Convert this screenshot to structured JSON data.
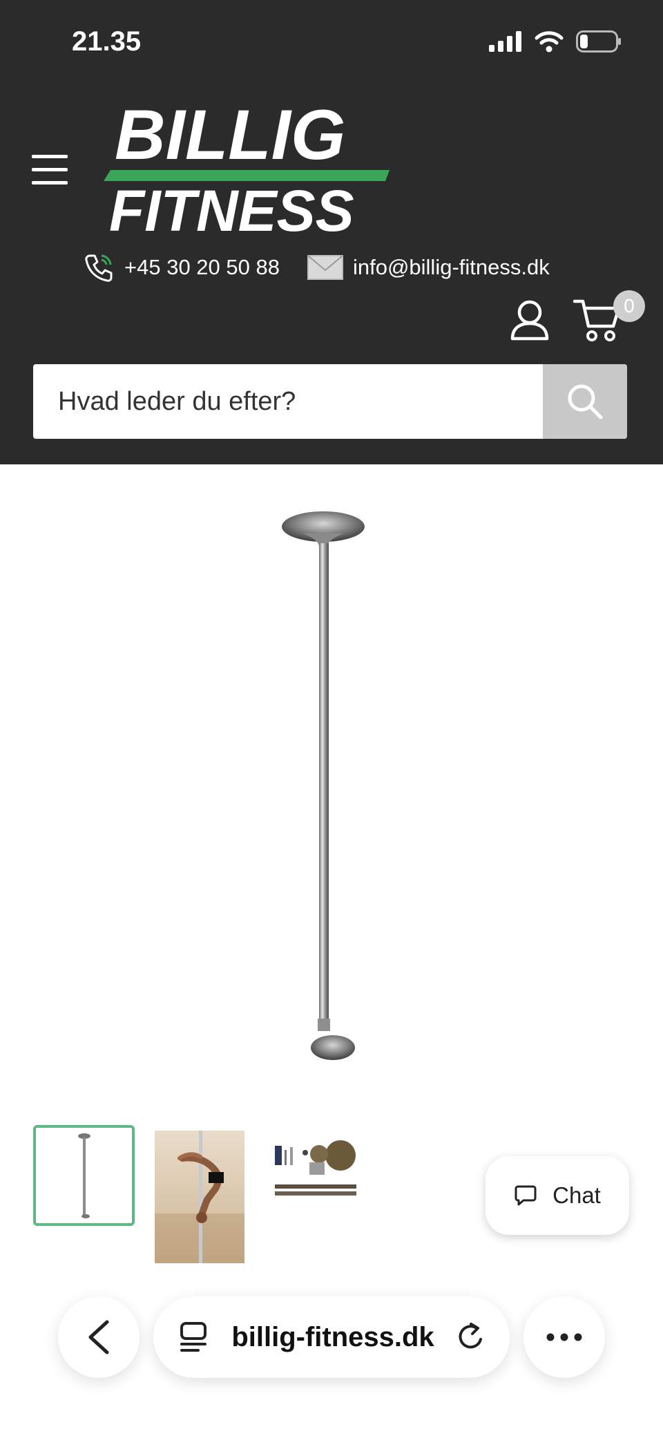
{
  "status_bar": {
    "time": "21.35",
    "icons": [
      "signal-icon",
      "wifi-icon",
      "battery-icon"
    ]
  },
  "header": {
    "logo": {
      "line1": "BILLIG",
      "line2": "FITNESS"
    },
    "phone": "+45 30 20 50 88",
    "email": "info@billig-fitness.dk",
    "cart_count": "0"
  },
  "search": {
    "placeholder": "Hvad leder du efter?"
  },
  "product": {
    "main_image": "pole-image",
    "thumbnails": [
      "pole-thumbnail",
      "pole-dancer-thumbnail",
      "pole-parts-thumbnail"
    ]
  },
  "chat": {
    "label": "Chat"
  },
  "browser": {
    "url": "billig-fitness.dk"
  },
  "colors": {
    "header_bg": "#2b2b2b",
    "brand_green": "#3aa65a",
    "thumb_active": "#5fb883"
  }
}
